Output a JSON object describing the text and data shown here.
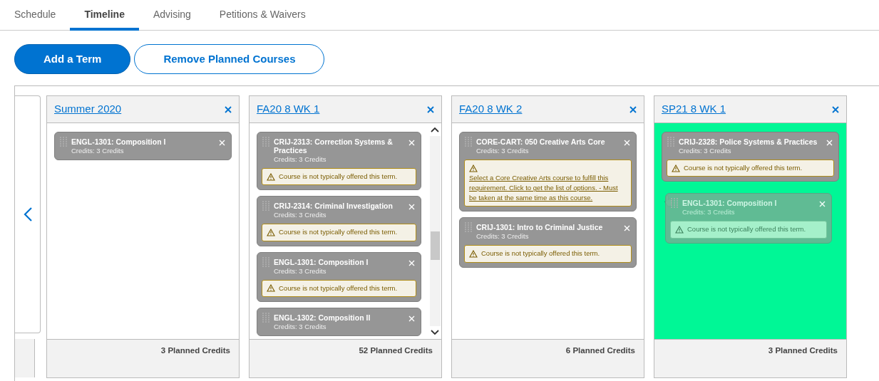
{
  "tabs": [
    {
      "label": "Schedule",
      "selected": false
    },
    {
      "label": "Timeline",
      "selected": true
    },
    {
      "label": "Advising",
      "selected": false
    },
    {
      "label": "Petitions & Waivers",
      "selected": false
    }
  ],
  "buttons": [
    {
      "label": "Add a Term",
      "kind": "primary"
    },
    {
      "label": "Remove Planned Courses",
      "kind": "outline"
    }
  ],
  "terms": [
    {
      "title": "Summer 2020",
      "drop_target": false,
      "scrollable": false,
      "footer": "3 Planned Credits",
      "courses": [
        {
          "title": "ENGL-1301: Composition I",
          "credits": "Credits: 3 Credits",
          "dragging": false
        }
      ]
    },
    {
      "title": "FA20 8 WK 1",
      "drop_target": false,
      "scrollable": true,
      "footer": "52 Planned Credits",
      "courses": [
        {
          "title": "CRIJ-2313: Correction Systems & Practices",
          "credits": "Credits: 3 Credits",
          "dragging": false,
          "warning": {
            "kind": "text",
            "text": "Course is not typically offered this term."
          }
        },
        {
          "title": "CRIJ-2314: Criminal Investigation",
          "credits": "Credits: 3 Credits",
          "dragging": false,
          "warning": {
            "kind": "text",
            "text": "Course is not typically offered this term."
          }
        },
        {
          "title": "ENGL-1301: Composition I",
          "credits": "Credits: 3 Credits",
          "dragging": false,
          "warning": {
            "kind": "text",
            "text": "Course is not typically offered this term."
          }
        },
        {
          "title": "ENGL-1302: Composition II",
          "credits": "Credits: 3 Credits",
          "dragging": false
        }
      ]
    },
    {
      "title": "FA20 8 WK 2",
      "drop_target": false,
      "scrollable": false,
      "footer": "6 Planned Credits",
      "courses": [
        {
          "title": "CORE-CART: 050 Creative Arts Core",
          "credits": "Credits: 3 Credits",
          "dragging": false,
          "warning": {
            "kind": "link",
            "text": "Select a Core Creative Arts course to fulfill this requirement. Click to get the list of options. - Must be taken at the same time as this course."
          }
        },
        {
          "title": "CRIJ-1301: Intro to Criminal Justice",
          "credits": "Credits: 3 Credits",
          "dragging": false,
          "warning": {
            "kind": "text",
            "text": "Course is not typically offered this term."
          }
        }
      ]
    },
    {
      "title": "SP21 8 WK 1",
      "drop_target": true,
      "scrollable": false,
      "footer": "3 Planned Credits",
      "courses": [
        {
          "title": "CRIJ-2328: Police Systems & Practices",
          "credits": "Credits: 3 Credits",
          "dragging": false,
          "warning": {
            "kind": "text",
            "text": "Course is not typically offered this term."
          }
        },
        {
          "title": "ENGL-1301: Composition I",
          "credits": "Credits: 3 Credits",
          "dragging": true,
          "warning": {
            "kind": "text",
            "text": "Course is not typically offered this term."
          }
        }
      ]
    }
  ]
}
